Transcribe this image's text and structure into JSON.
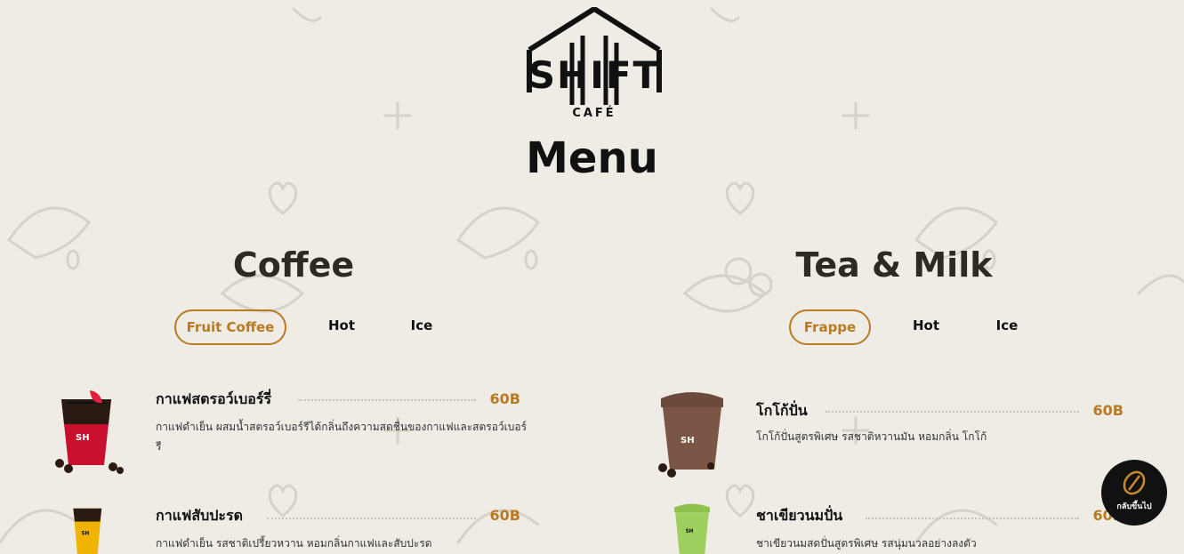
{
  "brand": {
    "logo_main": "SHIFT",
    "logo_sub": "CAFÉ"
  },
  "page_title": "Menu",
  "coffee": {
    "title": "Coffee",
    "tabs": [
      {
        "label": "Fruit Coffee",
        "active": true
      },
      {
        "label": "Hot",
        "active": false
      },
      {
        "label": "Ice",
        "active": false
      }
    ],
    "items": [
      {
        "name": "กาแฟสตรอว์เบอร์รี่",
        "price": "60B",
        "description": "กาแฟดำเย็น ผสมน้ำสตรอว์เบอร์รีได้กลิ่นถึงความสดชื่นของกาแฟและสตรอว์เบอร์รี"
      },
      {
        "name": "กาแฟสับปะรด",
        "price": "60B",
        "description": "กาแฟดำเย็น รสชาติเปรี้ยวหวาน หอมกลิ่นกาแฟและสับปะรด"
      }
    ]
  },
  "tea_milk": {
    "title": "Tea & Milk",
    "tabs": [
      {
        "label": "Frappe",
        "active": true
      },
      {
        "label": "Hot",
        "active": false
      },
      {
        "label": "Ice",
        "active": false
      }
    ],
    "items": [
      {
        "name": "โกโก้ปั่น",
        "price": "60B",
        "description": "โกโก้ปั่นสูตรพิเศษ รสชาติหวานมัน หอมกลิ่น โกโก้"
      },
      {
        "name": "ชาเขียวนมปั่น",
        "price": "60B",
        "description": "ชาเขียวนมสดปั่นสูตรพิเศษ รสนุ่มนวลอย่างลงตัว"
      }
    ]
  },
  "float_button": {
    "label": "กลับขึ้นไป",
    "icon": "coffee-bean-icon"
  },
  "colors": {
    "accent": "#b87a22",
    "background": "#efece6",
    "dark": "#111111"
  }
}
